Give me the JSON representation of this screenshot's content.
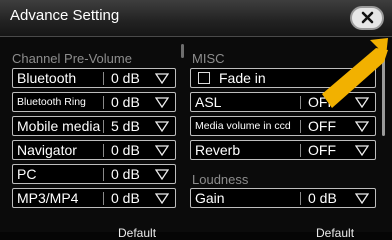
{
  "title": "Advance Setting",
  "close_icon": "close-x-icon",
  "left_panel": {
    "section": "Channel Pre-Volume",
    "items": [
      {
        "label": "Bluetooth",
        "value": "0 dB"
      },
      {
        "label": "Bluetooth Ring",
        "value": "0 dB"
      },
      {
        "label": "Mobile media",
        "value": "5 dB"
      },
      {
        "label": "Navigator",
        "value": "0 dB"
      },
      {
        "label": "PC",
        "value": "0 dB"
      },
      {
        "label": "MP3/MP4",
        "value": "0 dB"
      }
    ],
    "default_label": "Default"
  },
  "right_panel": {
    "section_misc": "MISC",
    "fade_in": "Fade in",
    "items": [
      {
        "label": "ASL",
        "value": "OFF"
      },
      {
        "label": "Media volume in ccd",
        "value": "OFF"
      },
      {
        "label": "Reverb",
        "value": "OFF"
      }
    ],
    "section_loudness": "Loudness",
    "gain": {
      "label": "Gain",
      "value": "0 dB"
    },
    "default_label": "Default"
  },
  "colors": {
    "annotation_arrow": "#f2b100",
    "row_border": "#bdbdbd",
    "section_text": "#8d8d8d"
  }
}
